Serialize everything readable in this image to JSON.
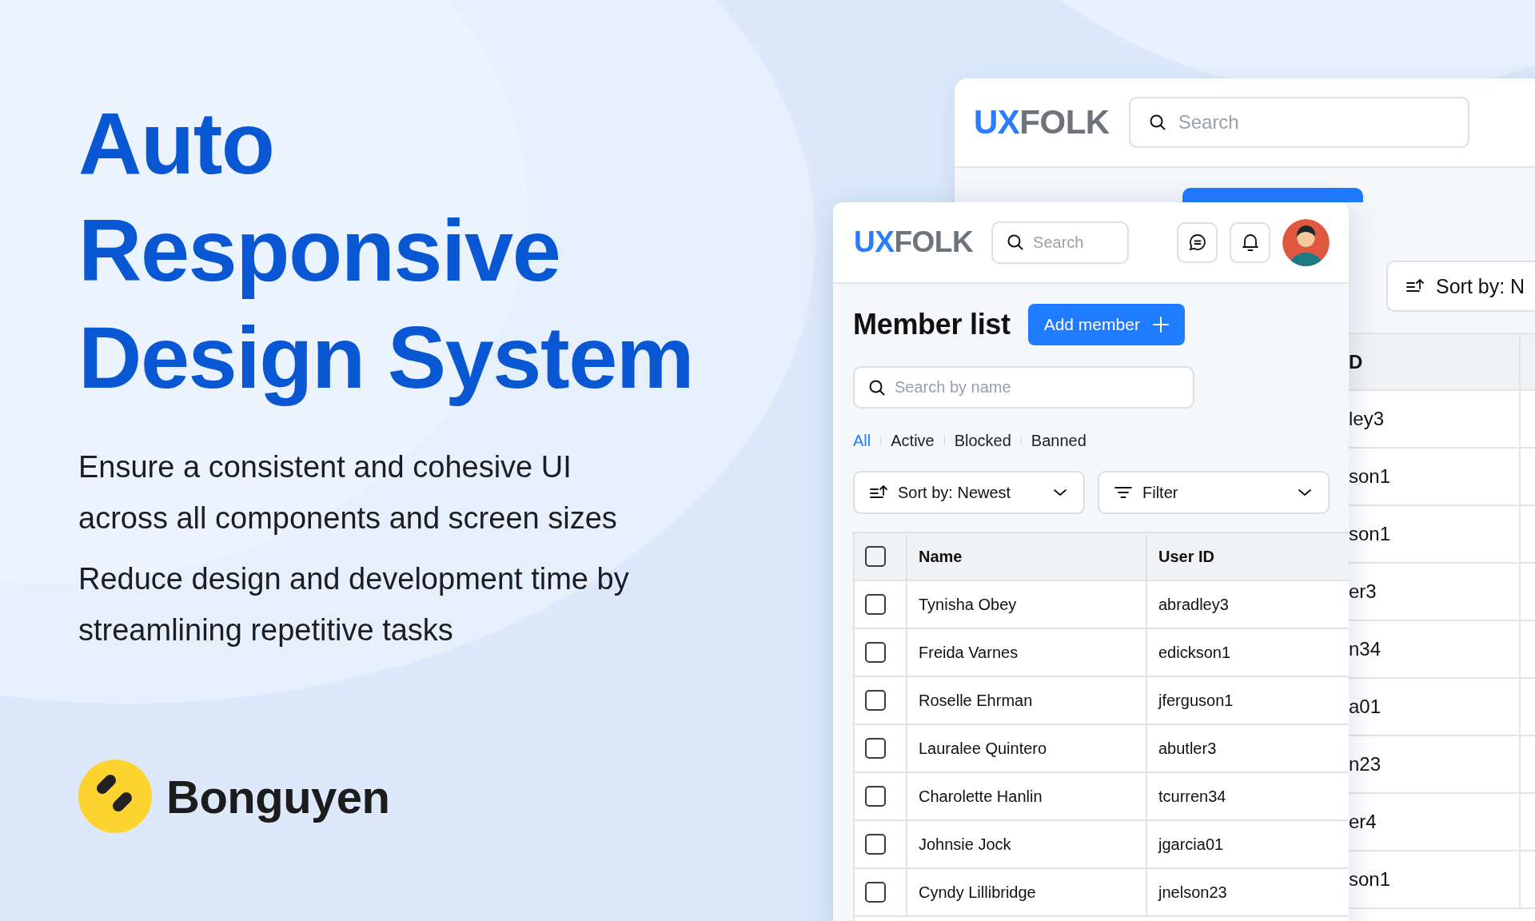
{
  "hero": {
    "title_lines": [
      "Auto",
      "Responsive",
      "Design System"
    ],
    "paragraphs": [
      "Ensure a consistent and cohesive UI across all components and screen sizes",
      "Reduce design and development time by streamlining repetitive tasks"
    ],
    "brand": {
      "name": "Bonguyen"
    }
  },
  "back_window": {
    "logo": {
      "accent": "UX",
      "rest": "FOLK"
    },
    "search": {
      "placeholder": "Search"
    },
    "sort_button": "Sort by: N",
    "table": {
      "column_header": "D",
      "cells": [
        "ley3",
        "son1",
        "son1",
        "er3",
        "n34",
        "a01",
        "n23",
        "er4",
        "son1"
      ]
    }
  },
  "front_window": {
    "logo": {
      "accent": "UX",
      "rest": "FOLK"
    },
    "search": {
      "placeholder": "Search"
    },
    "title": "Member list",
    "add_button": "Add member",
    "name_search": {
      "placeholder": "Search by name"
    },
    "tabs": [
      {
        "label": "All",
        "selected": true
      },
      {
        "label": "Active",
        "selected": false
      },
      {
        "label": "Blocked",
        "selected": false
      },
      {
        "label": "Banned",
        "selected": false
      }
    ],
    "sort": "Sort by: Newest",
    "filter": "Filter",
    "table": {
      "columns": [
        "Name",
        "User ID"
      ],
      "header_checked": false,
      "rows": [
        {
          "checked": false,
          "name": "Tynisha Obey",
          "user_id": "abradley3"
        },
        {
          "checked": false,
          "name": "Freida Varnes",
          "user_id": "edickson1"
        },
        {
          "checked": false,
          "name": "Roselle Ehrman",
          "user_id": "jferguson1"
        },
        {
          "checked": false,
          "name": "Lauralee Quintero",
          "user_id": "abutler3"
        },
        {
          "checked": false,
          "name": "Charolette Hanlin",
          "user_id": "tcurren34"
        },
        {
          "checked": false,
          "name": "Johnsie Jock",
          "user_id": "jgarcia01"
        },
        {
          "checked": false,
          "name": "Cyndy Lillibridge",
          "user_id": "jnelson23"
        }
      ]
    }
  }
}
